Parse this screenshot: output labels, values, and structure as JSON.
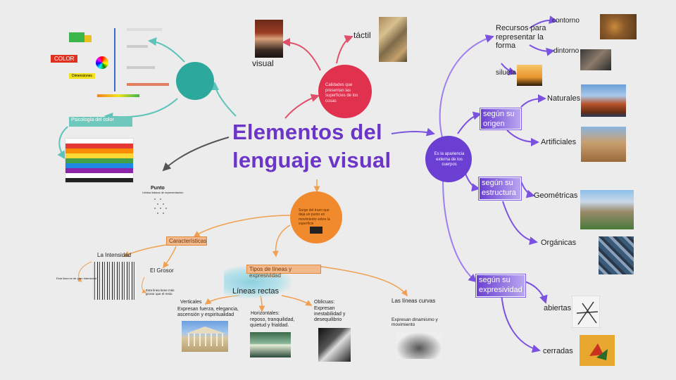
{
  "title": {
    "line1": "Elementos del",
    "line2": "lenguaje visual"
  },
  "colors": {
    "purple": "#6a3fd1",
    "orange": "#f08a2c",
    "red": "#e0314f",
    "teal": "#2ca89c",
    "title": "#6b35c8"
  },
  "red_node": {
    "text": "Calidades que presentan las superficies de los cosas",
    "labels": {
      "visual": "visual",
      "tactil": "táctil"
    }
  },
  "purple_node": {
    "text": "Es la apariencia externa de los cuerpos",
    "resources": {
      "heading": "Recursos para representar la forma",
      "contorno": "contorno",
      "dintorno": "dintorno",
      "silueta": "silueta"
    },
    "origen": {
      "chip": "según su origen",
      "naturales": "Naturales",
      "artificiales": "Artificiales"
    },
    "estructura": {
      "chip": "según su estructura",
      "geometricas": "Geométricas",
      "organicas": "Orgánicas"
    },
    "expresividad": {
      "chip": "según su expresividad",
      "abiertas": "abiertas",
      "cerradas": "cerradas"
    }
  },
  "orange_node": {
    "text": "Surge del trazo que deja un punto en movimiento sobre la superficie",
    "caracteristicas": "Características",
    "intensidad": "La Intensidad",
    "grosor": "El Grosor",
    "grosor_note": "Esta linea tiene más grosor que el resto",
    "intensidad_note": "Esta linea es de gran intensidad",
    "tipos": "Tipos de líneas y expresividad",
    "rectas": "Líneas rectas",
    "verticales": {
      "title": "Verticales",
      "desc": "Expresan fuerza, elegancia, ascensión y espiritualidad"
    },
    "horizontales": {
      "title": "Horizontales:",
      "desc": "reposo, tranquilidad, quietud y frialdad."
    },
    "oblicuas": {
      "title": "Oblicuas:",
      "desc": "Expresan inestabilidad y desequilibrio"
    },
    "curvas": {
      "title": "Las líneas curvas",
      "desc": "Expresan dinamismo y movimiento"
    }
  },
  "punto": {
    "title": "Punto",
    "subtitle": "Unidad básica de representación"
  },
  "teal_node": {
    "psicologia": "Psicología del color",
    "color_label": "COLOR",
    "dimensiones": "Dimensiones"
  }
}
